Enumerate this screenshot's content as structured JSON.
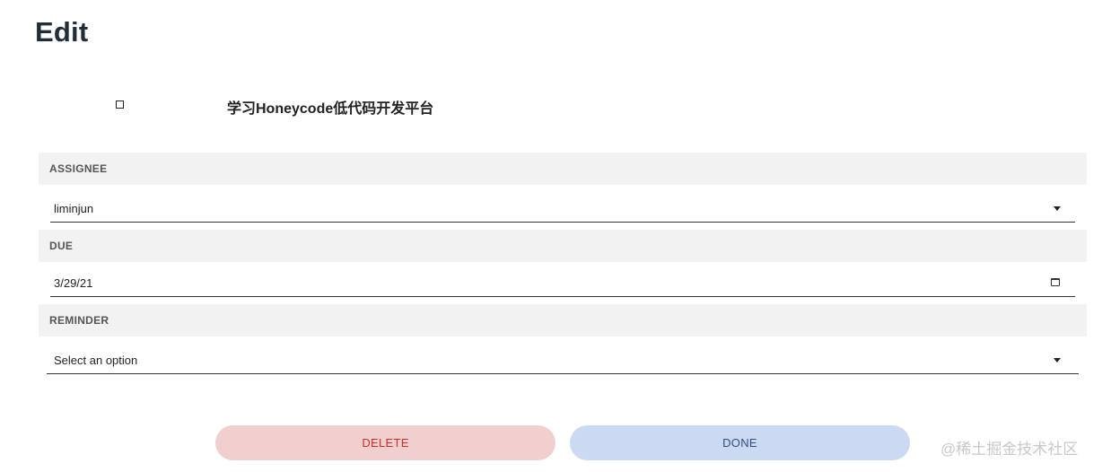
{
  "page": {
    "title": "Edit"
  },
  "task": {
    "name": "学习Honeycode低代码开发平台",
    "completed": false
  },
  "assignee": {
    "label": "ASSIGNEE",
    "value": "liminjun"
  },
  "due": {
    "label": "DUE",
    "value": "3/29/21"
  },
  "reminder": {
    "label": "REMINDER",
    "placeholder": "Select an option"
  },
  "actions": {
    "delete_label": "DELETE",
    "done_label": "DONE"
  },
  "watermark": "@稀土掘金技术社区",
  "colors": {
    "header_background": "#f2f2f2",
    "delete_background": "#f2cfcf",
    "delete_text": "#c9302c",
    "done_background": "#cbd9f3",
    "done_text": "#34507e"
  }
}
